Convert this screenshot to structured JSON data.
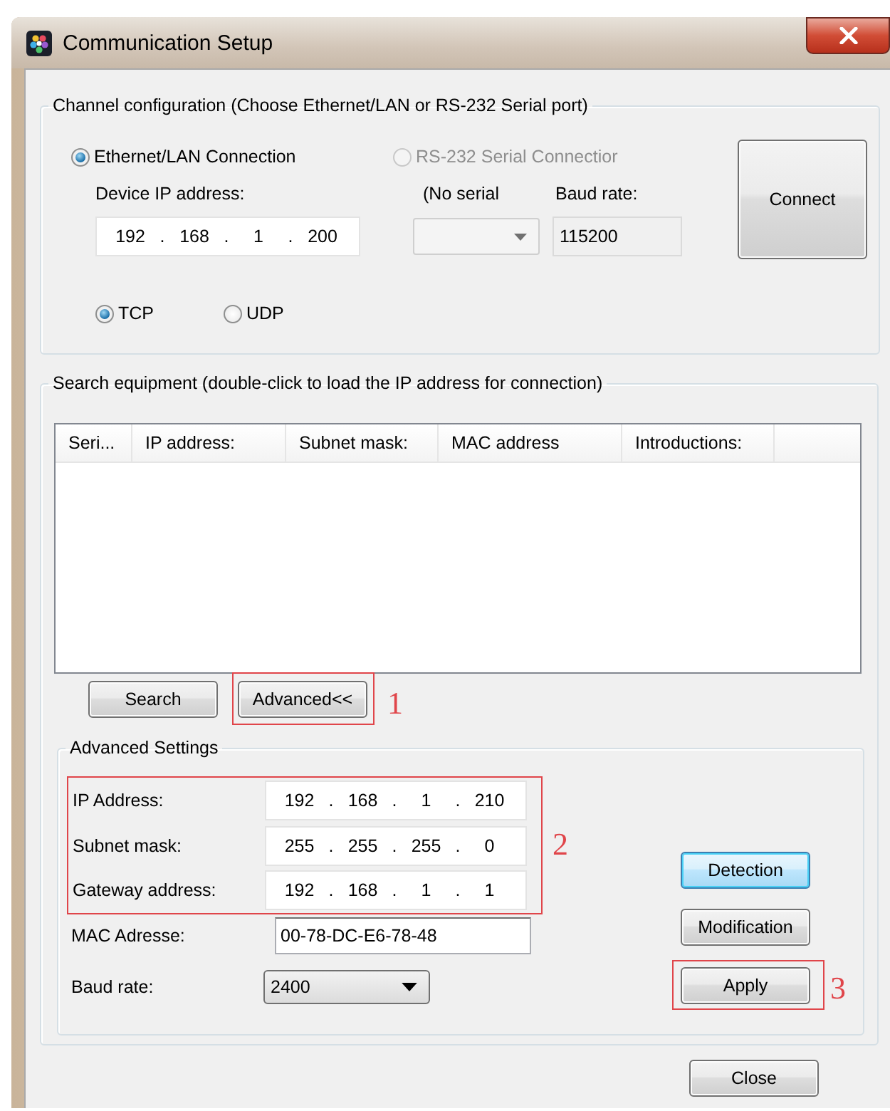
{
  "window": {
    "title": "Communication Setup"
  },
  "channel_config": {
    "title": "Channel configuration (Choose Ethernet/LAN or RS-232 Serial port)",
    "connections": [
      {
        "label": "Ethernet/LAN Connection",
        "selected": true,
        "disabled": false
      },
      {
        "label": "RS-232 Serial Connectior",
        "selected": false,
        "disabled": true
      }
    ],
    "device_ip": {
      "label": "Device IP address:",
      "octets": [
        "192",
        "168",
        "1",
        "200"
      ],
      "separator": "."
    },
    "serial_port": {
      "label": "(No serial",
      "disabled": true
    },
    "baud_rate": {
      "label": "Baud rate:",
      "value": "115200"
    },
    "connect_button": {
      "label": "Connect"
    },
    "protocols": [
      {
        "label": "TCP",
        "selected": true
      },
      {
        "label": "UDP",
        "selected": false
      }
    ]
  },
  "search_equipment": {
    "title": "Search equipment (double-click to load the IP address for connection)",
    "table": {
      "columns": [
        "Seri...",
        "IP address:",
        "Subnet mask:",
        "MAC address",
        "Introductions:"
      ]
    },
    "buttons": [
      {
        "label": "Search"
      },
      {
        "label": "Advanced<<",
        "annotation": "1"
      }
    ]
  },
  "advanced_settings": {
    "title": "Advanced Settings",
    "address_fields": [
      {
        "label": "IP Address:",
        "octets": [
          "192",
          "168",
          "1",
          "210"
        ],
        "separator": "."
      },
      {
        "label": "Subnet mask:",
        "octets": [
          "255",
          "255",
          "255",
          "0"
        ],
        "separator": "."
      },
      {
        "label": "Gateway address:",
        "octets": [
          "192",
          "168",
          "1",
          "1"
        ],
        "separator": "."
      }
    ],
    "address_annotation": "2",
    "mac": {
      "label": "MAC Adresse:",
      "value": "00-78-DC-E6-78-48"
    },
    "baud_rate": {
      "label": "Baud rate:",
      "value": "2400"
    },
    "buttons": [
      {
        "label": "Detection",
        "focused": true
      },
      {
        "label": "Modification",
        "focused": false
      },
      {
        "label": "Apply",
        "focused": false,
        "annotation": "3"
      }
    ]
  },
  "close_button": {
    "label": "Close"
  }
}
